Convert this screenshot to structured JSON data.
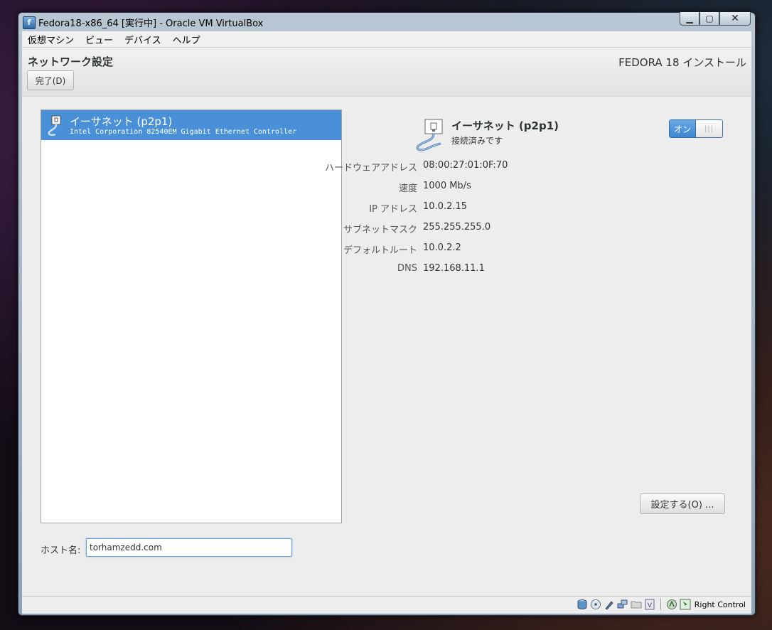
{
  "window": {
    "title": "Fedora18-x86_64 [実行中] - Oracle VM VirtualBox",
    "app_icon_glyph": "f"
  },
  "vm_menu": {
    "items": [
      "仮想マシン",
      "ビュー",
      "デバイス",
      "ヘルプ"
    ]
  },
  "header": {
    "page_title": "ネットワーク設定",
    "done_button": "完了(D)",
    "product_title": "FEDORA 18 インストール"
  },
  "devices": {
    "items": [
      {
        "name": "イーサネット (p2p1)",
        "description": "Intel Corporation 82540EM Gigabit Ethernet Controller",
        "selected": true
      }
    ]
  },
  "detail": {
    "name": "イーサネット (p2p1)",
    "status": "接続済みです",
    "toggle_label": "オン",
    "toggle_state": true,
    "properties": [
      {
        "label": "ハードウェアアドレス",
        "value": "08:00:27:01:0F:70"
      },
      {
        "label": "速度",
        "value": "1000 Mb/s"
      },
      {
        "label": "IP アドレス",
        "value": "10.0.2.15"
      },
      {
        "label": "サブネットマスク",
        "value": "255.255.255.0"
      },
      {
        "label": "デフォルトルート",
        "value": "10.0.2.2"
      },
      {
        "label": "DNS",
        "value": "192.168.11.1"
      }
    ],
    "configure_button": "設定する(O) ..."
  },
  "hostname": {
    "label": "ホスト名:",
    "value": "torhamzedd.com"
  },
  "statusbar": {
    "host_key": "Right Control",
    "icons": [
      "hard-disk-icon",
      "optical-drive-icon",
      "usb-icon",
      "network-icon",
      "shared-folders-icon",
      "video-capture-icon",
      "virtualization-icon",
      "mouse-integration-icon"
    ]
  },
  "colors": {
    "selection": "#4a90d9",
    "toggle_on": "#3d86d0",
    "guest_bg": "#ededed"
  }
}
